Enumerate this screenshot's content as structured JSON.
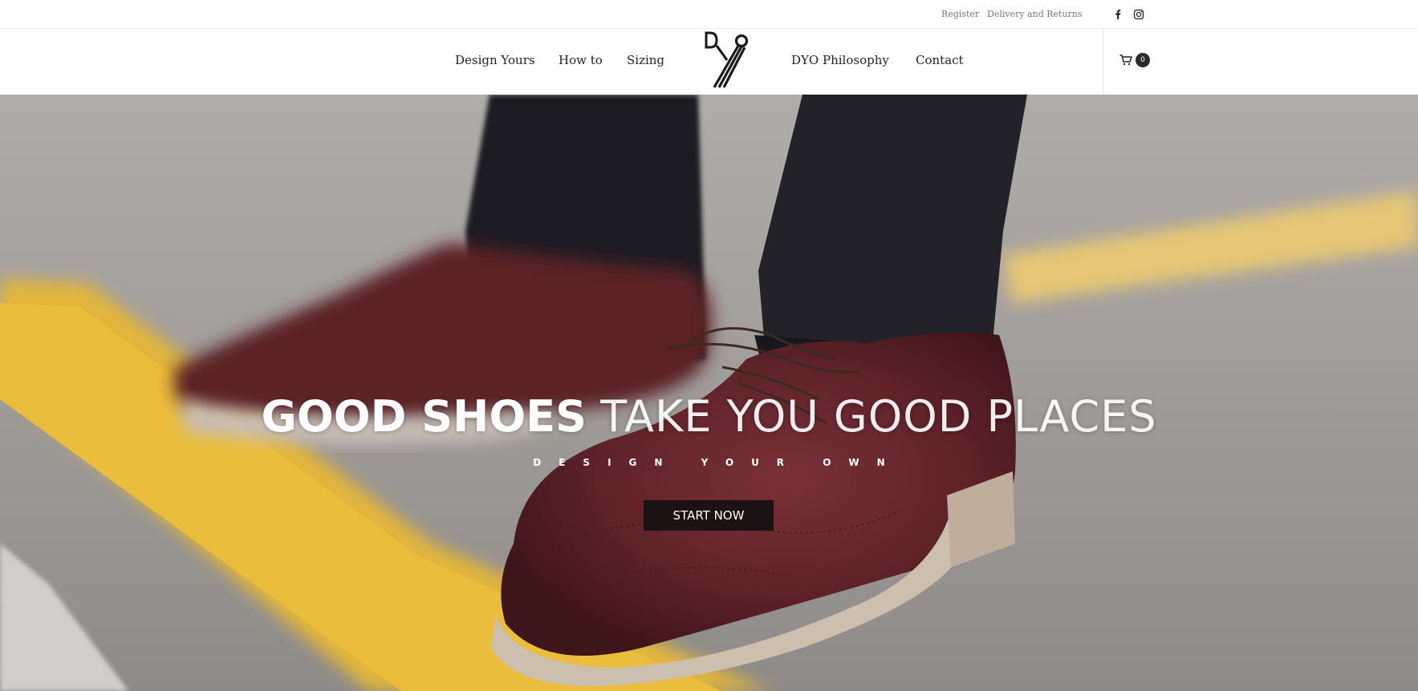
{
  "utility": {
    "register": "Register",
    "delivery": "Delivery and Returns",
    "social_icons": [
      "facebook-icon",
      "instagram-icon"
    ]
  },
  "nav": {
    "items": [
      "Design Yours",
      "How to",
      "Sizing",
      "DYO Philosophy",
      "Contact"
    ],
    "logo_icon": "dyo-logo",
    "cart_icon": "shopping-cart-icon",
    "cart_count": "0"
  },
  "hero": {
    "heading_bold": "GOOD SHOES",
    "heading_light": "TAKE YOU GOOD PLACES",
    "subheading": "DESIGN YOUR OWN",
    "cta": "START NOW"
  },
  "colors": {
    "nav_text": "#222222",
    "utility_text": "#777777",
    "cta_bg": "#1a1213",
    "cart_badge": "#2b2b2b",
    "hero_road": "#a8a4a1",
    "hero_stripe": "#e8b93a",
    "shoe": "#6b2a31"
  }
}
